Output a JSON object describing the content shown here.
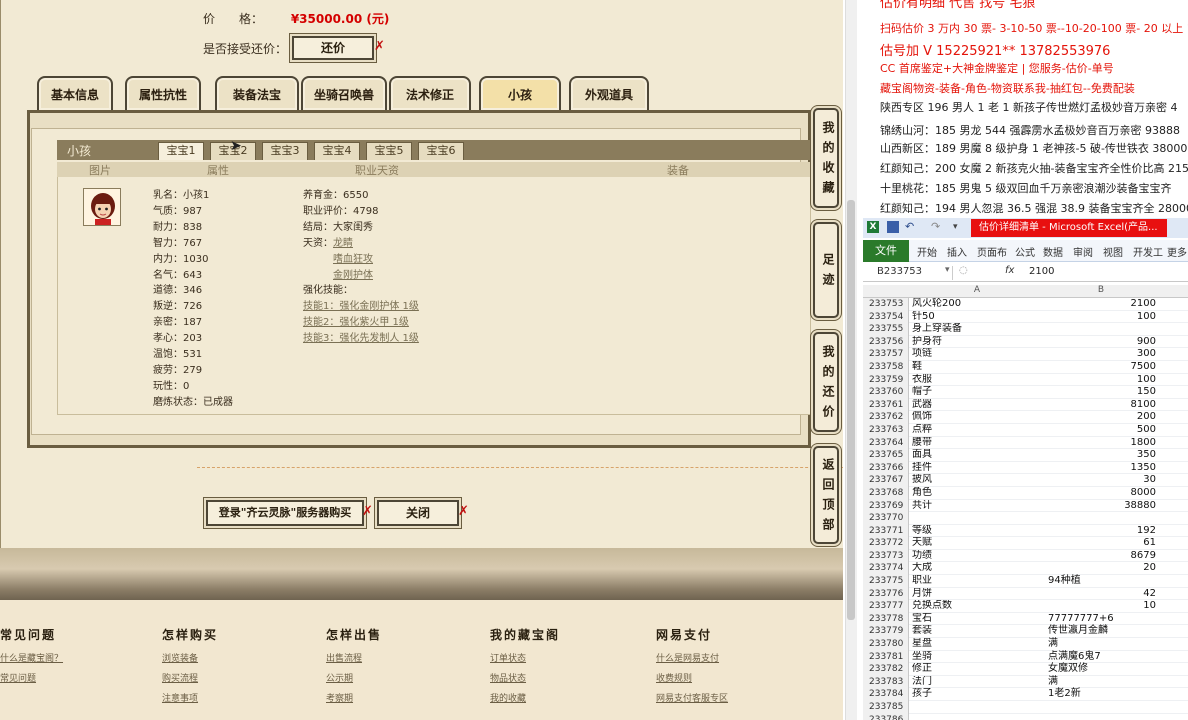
{
  "price": {
    "label": "价　　格：",
    "value": "¥35000.00 (元)"
  },
  "haggle": {
    "label": "是否接受还价：",
    "button": "还价"
  },
  "tabs": [
    "基本信息",
    "属性抗性",
    "装备法宝",
    "坐骑召唤兽",
    "法术修正",
    "小孩",
    "外观道具"
  ],
  "child_panel": {
    "title": "小孩",
    "subtabs": [
      "宝宝1",
      "宝宝2",
      "宝宝3",
      "宝宝4",
      "宝宝5",
      "宝宝6"
    ],
    "columns": [
      "图片",
      "属性",
      "职业天资",
      "装备"
    ],
    "stats": [
      "乳名：小孩1",
      "气质：987",
      "耐力：838",
      "智力：767",
      "内力：1030",
      "名气：643",
      "道德：346",
      "叛逆：726",
      "亲密：187",
      "孝心：203",
      "温饱：531",
      "疲劳：279",
      "玩性：0",
      "磨炼状态：已成器"
    ],
    "info_lines": [
      "养育金：6550",
      "职业评价：4798",
      "结局：大家闺秀",
      "天资：",
      "",
      "",
      "强化技能："
    ],
    "talents": [
      "龙睛",
      "嗜血狂攻",
      "金刚护体"
    ],
    "skills": [
      "技能1：强化金刚护体 1级",
      "技能2：强化紫火甲 1级",
      "技能3：强化先发制人 1级"
    ]
  },
  "buttons": {
    "login": "登录\"齐云灵脉\"服务器购买",
    "close": "关闭"
  },
  "side_buttons": [
    "我的收藏",
    "足迹",
    "我的还价",
    "返回顶部"
  ],
  "footer": [
    {
      "heading": "常见问题",
      "links": [
        "什么是藏宝阁？",
        "常见问题"
      ]
    },
    {
      "heading": "怎样购买",
      "links": [
        "浏览装备",
        "购买流程",
        "注意事项"
      ]
    },
    {
      "heading": "怎样出售",
      "links": [
        "出售流程",
        "公示期",
        "考察期"
      ]
    },
    {
      "heading": "我的藏宝阁",
      "links": [
        "订单状态",
        "物品状态",
        "我的收藏"
      ]
    },
    {
      "heading": "网易支付",
      "links": [
        "什么是网易支付",
        "收费规则",
        "网易支付客服专区"
      ]
    }
  ],
  "ad_lines": [
    {
      "text": "估价有明细 代售 找号 宅狼",
      "style": "red big"
    },
    {
      "text": "扫码估价 3 万内 30 票- 3-10-50 票--10-20-100 票- 20 以上 150-",
      "style": "red"
    },
    {
      "text": "估号加 V 15225921**  13782553976",
      "style": "red big"
    },
    {
      "text": "CC 首席鉴定+大神金牌鉴定 | 您服务-估价-单号",
      "style": "red"
    },
    {
      "text": "藏宝阁物资-装备-角色-物资联系我-抽红包--免费配装",
      "style": "red"
    },
    {
      "text": "陕西专区 196 男人 1 老 1 新孩子传世燃灯孟极妙音万亲密 4",
      "style": "blk"
    },
    {
      "text": "锦绣山河：185 男龙 544 强霹雳水孟极妙音百万亲密 93888",
      "style": "blk"
    },
    {
      "text": "山西新区：189 男魔 8 级护身 1 老神孩-5 破-传世铁衣 38000",
      "style": "blk"
    },
    {
      "text": "红颜知己：200 女魔 2 新孩克火抽-装备宝宝齐全性价比高 215",
      "style": "blk"
    },
    {
      "text": "十里桃花：185 男鬼 5 级双回血千万亲密浪潮沙装备宝宝齐",
      "style": "blk"
    },
    {
      "text": "红颜知己：194 男人忽混 36.5 强混 38.9 装备宝宝齐全 28000",
      "style": "blk"
    }
  ],
  "excel": {
    "title": "估价详细清单 - Microsoft Excel(产品...",
    "ribbon_tabs": [
      "文件",
      "开始",
      "插入",
      "页面布",
      "公式",
      "数据",
      "审阅",
      "视图",
      "开发工",
      "更多"
    ],
    "name_box": "B233753",
    "fx": "fx",
    "formula_value": "2100",
    "col_a": "A",
    "col_b": "B",
    "rows": [
      {
        "n": "233753",
        "a": "风火轮200",
        "b": "2100"
      },
      {
        "n": "233754",
        "a": "针50",
        "b": "100"
      },
      {
        "n": "233755",
        "a": "身上穿装备",
        "b": ""
      },
      {
        "n": "233756",
        "a": "护身符",
        "b": "900"
      },
      {
        "n": "233757",
        "a": "项链",
        "b": "300"
      },
      {
        "n": "233758",
        "a": "鞋",
        "b": "7500"
      },
      {
        "n": "233759",
        "a": "衣服",
        "b": "100"
      },
      {
        "n": "233760",
        "a": "帽子",
        "b": "150"
      },
      {
        "n": "233761",
        "a": "武器",
        "b": "8100"
      },
      {
        "n": "233762",
        "a": "佩饰",
        "b": "200"
      },
      {
        "n": "233763",
        "a": "点粹",
        "b": "500"
      },
      {
        "n": "233764",
        "a": "腰带",
        "b": "1800"
      },
      {
        "n": "233765",
        "a": "面具",
        "b": "350"
      },
      {
        "n": "233766",
        "a": "挂件",
        "b": "1350"
      },
      {
        "n": "233767",
        "a": "披风",
        "b": "30"
      },
      {
        "n": "233768",
        "a": "角色",
        "b": "8000"
      },
      {
        "n": "233769",
        "a": "共计",
        "b": "38880"
      },
      {
        "n": "233770",
        "a": "",
        "b": ""
      },
      {
        "n": "233771",
        "a": "等级",
        "b": "192"
      },
      {
        "n": "233772",
        "a": "天赋",
        "b": "61"
      },
      {
        "n": "233773",
        "a": "功绩",
        "b": "8679"
      },
      {
        "n": "233774",
        "a": "大成",
        "b": "20"
      },
      {
        "n": "233775",
        "a": "职业",
        "b": "94种植",
        "left": true
      },
      {
        "n": "233776",
        "a": "月饼",
        "b": "42"
      },
      {
        "n": "233777",
        "a": "兑换点数",
        "b": "10"
      },
      {
        "n": "233778",
        "a": "宝石",
        "b": "77777777+6",
        "left": true
      },
      {
        "n": "233779",
        "a": "套装",
        "b": "传世瀛月金麟",
        "left": true
      },
      {
        "n": "233780",
        "a": "星盘",
        "b": "满",
        "left": true
      },
      {
        "n": "233781",
        "a": "坐骑",
        "b": "点满魔6鬼7",
        "left": true
      },
      {
        "n": "233782",
        "a": "修正",
        "b": "女魔双修",
        "left": true
      },
      {
        "n": "233783",
        "a": "法门",
        "b": "满",
        "left": true
      },
      {
        "n": "233784",
        "a": "孩子",
        "b": "1老2新",
        "left": true
      },
      {
        "n": "233785",
        "a": "",
        "b": ""
      },
      {
        "n": "233786",
        "a": "",
        "b": ""
      }
    ]
  }
}
